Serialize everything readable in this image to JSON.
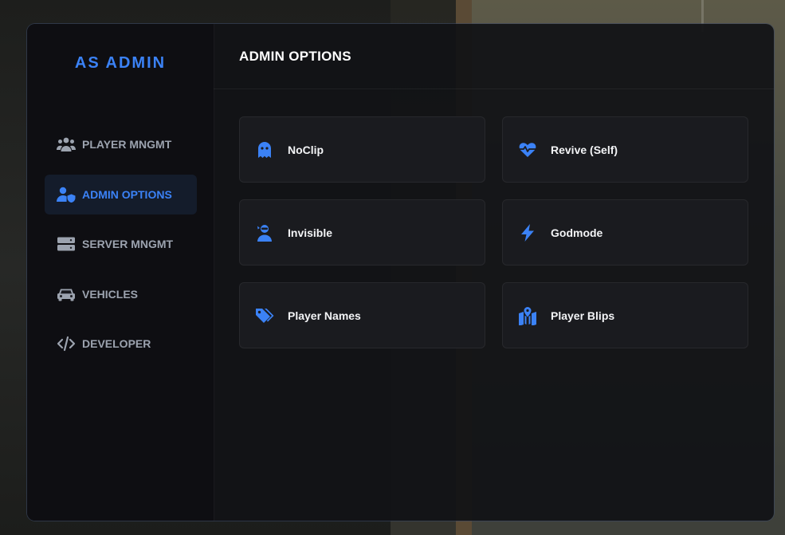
{
  "brand": {
    "title": "AS ADMIN"
  },
  "sidebar": {
    "items": [
      {
        "label": "PLAYER MNGMT",
        "icon": "users-icon",
        "active": false
      },
      {
        "label": "ADMIN OPTIONS",
        "icon": "user-shield-icon",
        "active": true
      },
      {
        "label": "SERVER MNGMT",
        "icon": "server-icon",
        "active": false
      },
      {
        "label": "VEHICLES",
        "icon": "car-icon",
        "active": false
      },
      {
        "label": "DEVELOPER",
        "icon": "code-icon",
        "active": false
      }
    ]
  },
  "main": {
    "title": "ADMIN OPTIONS",
    "options": [
      {
        "label": "NoClip",
        "icon": "ghost-icon"
      },
      {
        "label": "Revive (Self)",
        "icon": "heart-pulse-icon"
      },
      {
        "label": "Invisible",
        "icon": "user-ninja-icon"
      },
      {
        "label": "Godmode",
        "icon": "bolt-icon"
      },
      {
        "label": "Player Names",
        "icon": "tags-icon"
      },
      {
        "label": "Player Blips",
        "icon": "map-location-icon"
      }
    ]
  },
  "colors": {
    "accent": "#3b82f6",
    "text_muted": "#9ca3af",
    "text_primary": "#ffffff",
    "panel_bg": "#111216",
    "card_bg": "#1a1b1f",
    "active_bg": "#141c2b"
  }
}
